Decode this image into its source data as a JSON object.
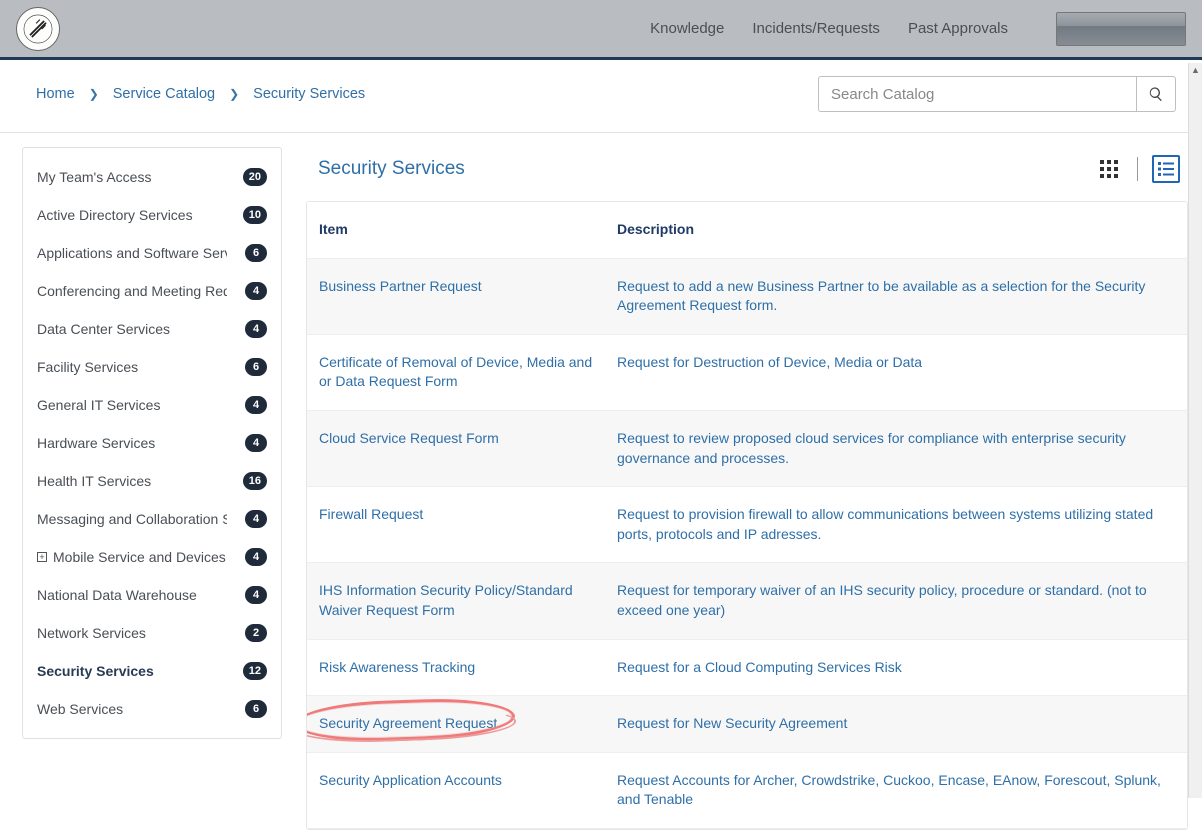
{
  "topnav": {
    "items": [
      "Knowledge",
      "Incidents/Requests",
      "Past Approvals"
    ]
  },
  "breadcrumb": {
    "items": [
      "Home",
      "Service Catalog",
      "Security Services"
    ]
  },
  "search": {
    "placeholder": "Search Catalog"
  },
  "sidebar": {
    "items": [
      {
        "label": "My Team's Access",
        "count": 20
      },
      {
        "label": "Active Directory Services",
        "count": 10
      },
      {
        "label": "Applications and Software Services",
        "count": 6
      },
      {
        "label": "Conferencing and Meeting Reque…",
        "count": 4
      },
      {
        "label": "Data Center Services",
        "count": 4
      },
      {
        "label": "Facility Services",
        "count": 6
      },
      {
        "label": "General IT Services",
        "count": 4
      },
      {
        "label": "Hardware Services",
        "count": 4
      },
      {
        "label": "Health IT Services",
        "count": 16
      },
      {
        "label": "Messaging and Collaboration Ser…",
        "count": 4
      },
      {
        "label": "Mobile Service and Devices, D…",
        "count": 4,
        "expandable": true
      },
      {
        "label": "National Data Warehouse",
        "count": 4
      },
      {
        "label": "Network Services",
        "count": 2
      },
      {
        "label": "Security Services",
        "count": 12,
        "active": true
      },
      {
        "label": "Web Services",
        "count": 6
      }
    ]
  },
  "content": {
    "title": "Security Services",
    "columns": {
      "item": "Item",
      "desc": "Description"
    },
    "rows": [
      {
        "item": "Business Partner Request",
        "desc": "Request to add a new Business Partner to be available as a selection for the Security Agreement Request form."
      },
      {
        "item": "Certificate of Removal of Device, Media and or Data Request Form",
        "desc": "Request for Destruction of Device, Media or Data"
      },
      {
        "item": "Cloud Service Request Form",
        "desc": "Request to review proposed cloud services for compliance with enterprise security governance and processes."
      },
      {
        "item": "Firewall Request",
        "desc": "Request to provision firewall to allow communications between systems utilizing stated ports, protocols and IP adresses."
      },
      {
        "item": "IHS Information Security Policy/Standard Waiver Request Form",
        "desc": "Request for temporary waiver of an IHS security policy, procedure or standard. (not to exceed one year)"
      },
      {
        "item": "Risk Awareness Tracking",
        "desc": "Request for a Cloud Computing Services Risk"
      },
      {
        "item": "Security Agreement Request",
        "desc": "Request for New Security Agreement",
        "highlighted": true
      },
      {
        "item": "Security Application Accounts",
        "desc": "Request Accounts for Archer, Crowdstrike, Cuckoo, Encase, EAnow, Forescout, Splunk, and Tenable"
      }
    ]
  }
}
